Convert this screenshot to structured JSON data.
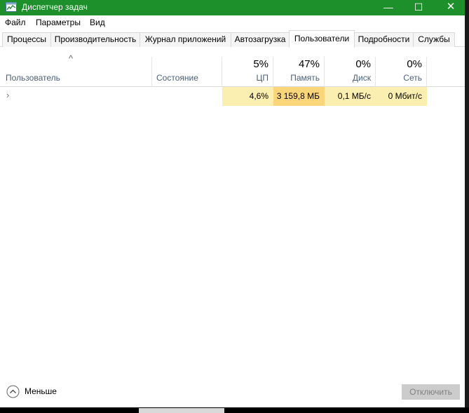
{
  "window": {
    "title": "Диспетчер задач",
    "title_color": "#1d8f2b",
    "controls": {
      "minimize": "—",
      "maximize": "☐",
      "close": "✕"
    }
  },
  "menu": {
    "items": [
      "Файл",
      "Параметры",
      "Вид"
    ]
  },
  "tabs": [
    {
      "label": "Процессы",
      "active": false
    },
    {
      "label": "Производительность",
      "active": false
    },
    {
      "label": "Журнал приложений",
      "active": false
    },
    {
      "label": "Автозагрузка",
      "active": false
    },
    {
      "label": "Пользователи",
      "active": true
    },
    {
      "label": "Подробности",
      "active": false
    },
    {
      "label": "Службы",
      "active": false
    }
  ],
  "columns": {
    "sort_indicator": "^",
    "user": {
      "label": "Пользователь"
    },
    "status": {
      "label": "Состояние"
    },
    "cpu": {
      "percent": "5%",
      "label": "ЦП"
    },
    "memory": {
      "percent": "47%",
      "label": "Память"
    },
    "disk": {
      "percent": "0%",
      "label": "Диск"
    },
    "network": {
      "percent": "0%",
      "label": "Сеть"
    }
  },
  "rows": [
    {
      "expand_icon": "›",
      "user": "",
      "status": "",
      "cpu": "4,6%",
      "memory": "3 159,8 МБ",
      "disk": "0,1 МБ/с",
      "network": "0 Мбит/с"
    }
  ],
  "footer": {
    "less_label": "Меньше",
    "end_button": "Отключить"
  },
  "colors": {
    "heat_low": "#fbeeb1",
    "heat_mid": "#fbd57a",
    "header_label": "#4c607a"
  }
}
